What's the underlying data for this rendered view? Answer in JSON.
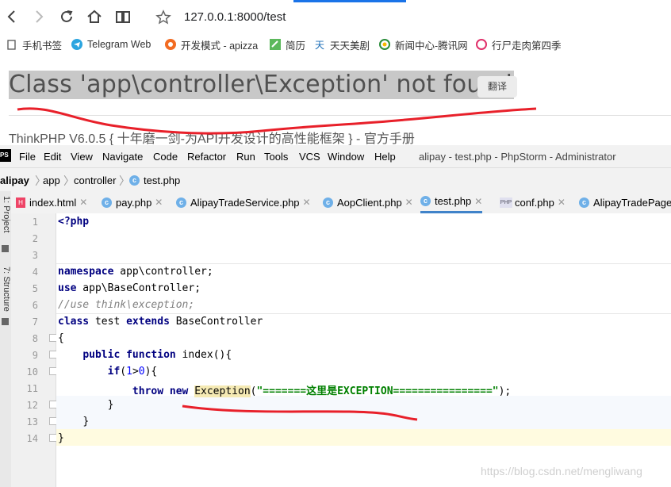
{
  "browser": {
    "url": "127.0.0.1:8000/test",
    "bookmarks": [
      {
        "label": "手机书签",
        "icon": "folder-icon"
      },
      {
        "label": "Telegram Web",
        "icon": "telegram-icon"
      },
      {
        "label": "开发模式 - apizza",
        "icon": "apizza-icon"
      },
      {
        "label": "简历",
        "icon": "resume-icon"
      },
      {
        "label": "天天美剧",
        "icon": "tv-icon"
      },
      {
        "label": "新闻中心-腾讯网",
        "icon": "tencent-icon"
      },
      {
        "label": "行尸走肉第四季",
        "icon": "video-icon"
      }
    ]
  },
  "page": {
    "error_title": "Class 'app\\controller\\Exception' not found",
    "translate_label": "翻译",
    "footer_link": "ThinkPHP",
    "footer_text": " V6.0.5 { 十年磨一剑-为API开发设计的高性能框架 } - ",
    "footer_manual": "官方手册"
  },
  "ide": {
    "menu": [
      "File",
      "Edit",
      "View",
      "Navigate",
      "Code",
      "Refactor",
      "Run",
      "Tools",
      "VCS",
      "Window",
      "Help"
    ],
    "window_title": "alipay - test.php - PhpStorm - Administrator",
    "breadcrumb": [
      "alipay",
      "app",
      "controller",
      "test.php"
    ],
    "tabs": [
      {
        "label": "index.html",
        "icon": "html-file-icon"
      },
      {
        "label": "pay.php",
        "icon": "php-class-icon"
      },
      {
        "label": "AlipayTradeService.php",
        "icon": "php-class-icon"
      },
      {
        "label": "AopClient.php",
        "icon": "php-class-icon"
      },
      {
        "label": "test.php",
        "icon": "php-class-icon",
        "active": true
      },
      {
        "label": "conf.php",
        "icon": "php-file-icon"
      },
      {
        "label": "AlipayTradePage",
        "icon": "php-class-icon"
      }
    ],
    "side_panels": [
      "1: Project",
      "7: Structure"
    ],
    "line_numbers": [
      "1",
      "2",
      "3",
      "4",
      "5",
      "6",
      "7",
      "8",
      "9",
      "10",
      "11",
      "12",
      "13",
      "14"
    ],
    "code": {
      "l1": "<?php",
      "l4_kw": "namespace",
      "l4_rest": " app\\controller;",
      "l5_kw": "use",
      "l5_rest": " app\\BaseController;",
      "l6": "//use think\\exception;",
      "l7_kw1": "class",
      "l7_mid": " test ",
      "l7_kw2": "extends",
      "l7_rest": " BaseController",
      "l8": "{",
      "l9_kw1": "public",
      "l9_kw2": "function",
      "l9_rest": " index(){",
      "l10_kw": "if",
      "l10_a": "(",
      "l10_n1": "1",
      "l10_op": ">",
      "l10_n2": "0",
      "l10_b": "){",
      "l11_kw1": "throw",
      "l11_kw2": "new",
      "l11_cls": "Exception",
      "l11_str": "\"=======这里是EXCEPTION================\"",
      "l11_end": ");",
      "l12": "}",
      "l13": "}",
      "l14": "}"
    }
  },
  "watermark": "https://blog.csdn.net/mengliwang"
}
